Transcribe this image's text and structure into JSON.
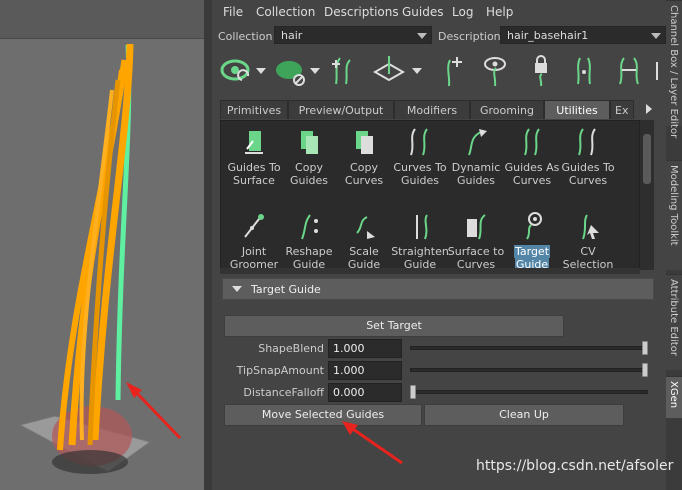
{
  "menu": [
    "File",
    "Collection",
    "Descriptions",
    "Guides",
    "Log",
    "Help"
  ],
  "collection": {
    "label": "Collection",
    "value": "hair"
  },
  "description": {
    "label": "Description",
    "value": "hair_basehair1"
  },
  "toolbar_icons": [
    "create-description-icon",
    "paint-mask-icon",
    "add-guide-icon",
    "move-guide-icon",
    "add-point-icon",
    "show-guide-icon",
    "lock-guide-icon",
    "sculpt-guide-icon",
    "flip-guide-icon"
  ],
  "tabs": [
    "Primitives",
    "Preview/Output",
    "Modifiers",
    "Grooming",
    "Utilities",
    "Ex"
  ],
  "active_tab": "Utilities",
  "tools_row1": [
    {
      "line1": "Guides To",
      "line2": "Surface"
    },
    {
      "line1": "Copy",
      "line2": "Guides"
    },
    {
      "line1": "Copy",
      "line2": "Curves"
    },
    {
      "line1": "Curves To",
      "line2": "Guides"
    },
    {
      "line1": "Dynamic",
      "line2": "Guides"
    },
    {
      "line1": "Guides As",
      "line2": "Curves"
    },
    {
      "line1": "Guides To",
      "line2": "Curves"
    }
  ],
  "tools_row2": [
    {
      "line1": "Joint",
      "line2": "Groomer"
    },
    {
      "line1": "Reshape",
      "line2": "Guide"
    },
    {
      "line1": "Scale",
      "line2": "Guide"
    },
    {
      "line1": "Straighten",
      "line2": "Guide"
    },
    {
      "line1": "Surface to",
      "line2": "Curves"
    },
    {
      "line1": "Target",
      "line2": "Guide"
    },
    {
      "line1": "CV",
      "line2": "Selection"
    }
  ],
  "section": {
    "title": "Target Guide"
  },
  "buttons": {
    "set_target": "Set Target",
    "move_selected": "Move Selected Guides",
    "clean_up": "Clean Up"
  },
  "params": [
    {
      "label": "ShapeBlend",
      "value": "1.000",
      "level": 1.0
    },
    {
      "label": "TipSnapAmount",
      "value": "1.000",
      "level": 1.0
    },
    {
      "label": "DistanceFalloff",
      "value": "0.000",
      "level": 0.0
    }
  ],
  "side_tabs": [
    "Channel Box / Layer Editor",
    "Modeling Toolkit",
    "Attribute Editor",
    "XGen"
  ],
  "active_side_tab": "XGen",
  "watermark": "https://blog.csdn.net/afsoler",
  "colors": {
    "hair_orange": "#ffa500",
    "hair_green": "#5ef0a0",
    "arrow_red": "#e8221c",
    "selection_blue": "#5285a6"
  }
}
